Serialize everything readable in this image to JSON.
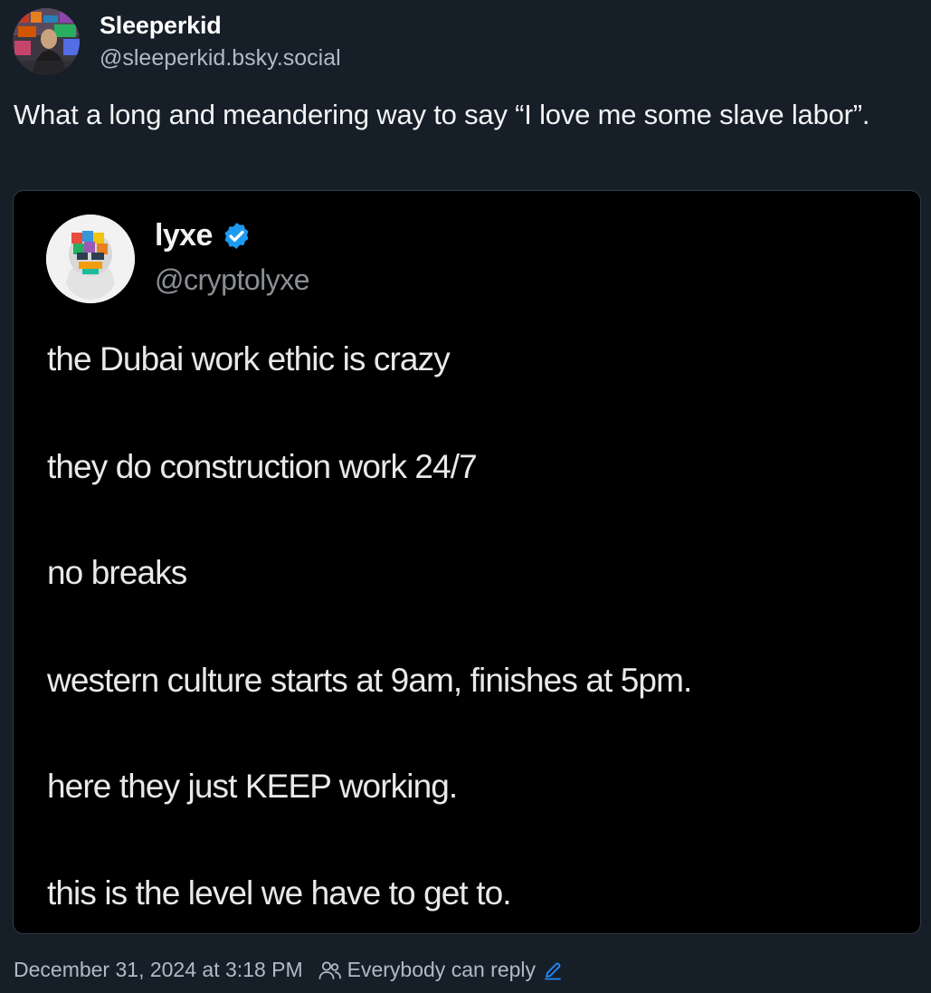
{
  "post": {
    "author": {
      "display_name": "Sleeperkid",
      "handle": "@sleeperkid.bsky.social"
    },
    "text": "What a long and meandering way to say “I love me some slave labor”.",
    "timestamp": "December 31, 2024 at 3:18 PM",
    "reply_setting": "Everybody can reply"
  },
  "embed": {
    "author": {
      "display_name": "lyxe",
      "handle": "@cryptolyxe",
      "verified": true
    },
    "lines": [
      "the Dubai work ethic is crazy",
      "they do construction work 24/7",
      "no breaks",
      "western culture starts at 9am, finishes at 5pm.",
      "here they just KEEP working.",
      "this is the level we have to get to."
    ]
  },
  "icons": {
    "verified": "verified-badge-icon",
    "people": "people-icon",
    "edit": "pencil-icon"
  },
  "colors": {
    "background": "#161e27",
    "embed_background": "#000000",
    "accent": "#208bfe",
    "secondary_text": "#aebbc9"
  }
}
